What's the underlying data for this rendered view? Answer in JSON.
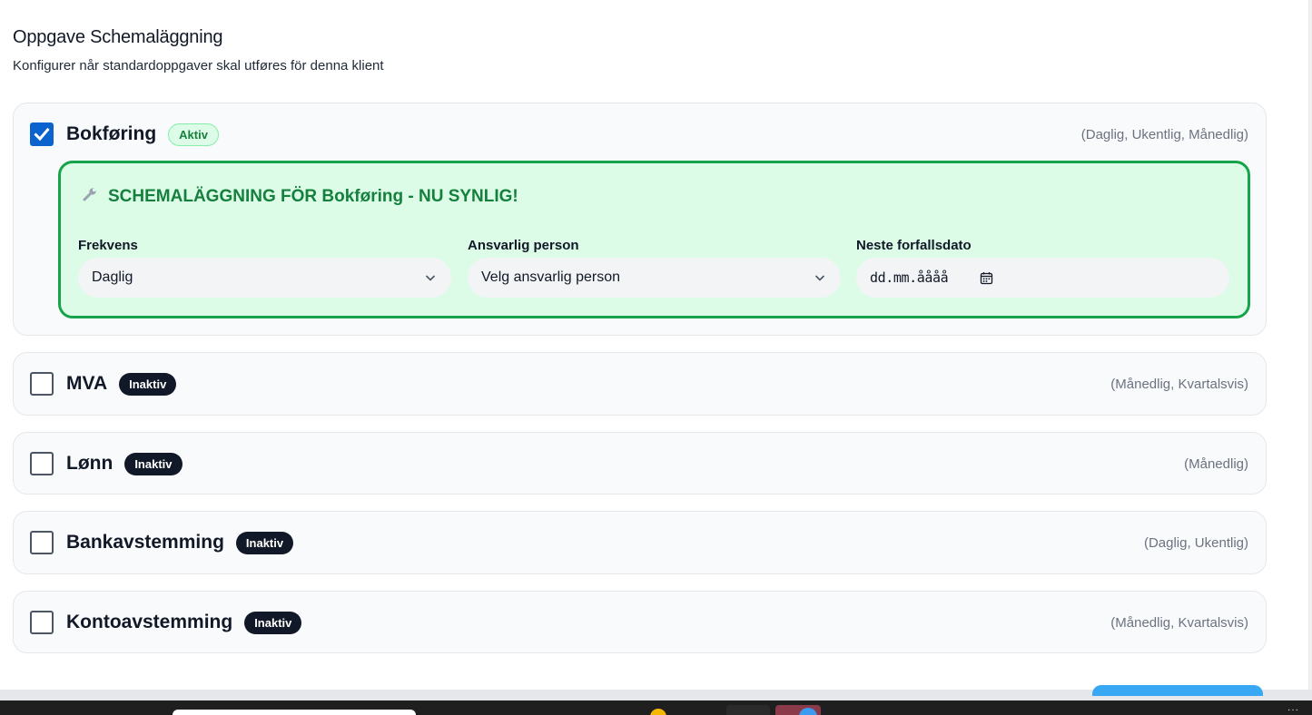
{
  "header": {
    "title": "Oppgave Schemaläggning",
    "subtitle": "Konfigurer når standardoppgaver skal utføres för denna klient"
  },
  "tasks": [
    {
      "name": "Bokføring",
      "checked": true,
      "status": "Aktiv",
      "frequencies": "(Daglig, Ukentlig, Månedlig)"
    },
    {
      "name": "MVA",
      "checked": false,
      "status": "Inaktiv",
      "frequencies": "(Månedlig, Kvartalsvis)"
    },
    {
      "name": "Lønn",
      "checked": false,
      "status": "Inaktiv",
      "frequencies": "(Månedlig)"
    },
    {
      "name": "Bankavstemming",
      "checked": false,
      "status": "Inaktiv",
      "frequencies": "(Daglig, Ukentlig)"
    },
    {
      "name": "Kontoavstemming",
      "checked": false,
      "status": "Inaktiv",
      "frequencies": "(Månedlig, Kvartalsvis)"
    }
  ],
  "schedule": {
    "heading": "SCHEMALÄGGNING FÖR Bokføring - NU SYNLIG!",
    "heading_icon": "wrench-icon",
    "frequency_label": "Frekvens",
    "frequency_value": "Daglig",
    "responsible_label": "Ansvarlig person",
    "responsible_value": "Velg ansvarlig person",
    "due_date_label": "Neste forfallsdato",
    "due_date_placeholder": "dd.mm.åååå"
  },
  "colors": {
    "checkbox_checked": "#0b63ce",
    "active_badge_bg": "#dcfce7",
    "active_badge_text": "#15803d",
    "inactive_badge_bg": "#111827",
    "panel_border": "#16a34a",
    "panel_bg": "#dcfce7"
  }
}
